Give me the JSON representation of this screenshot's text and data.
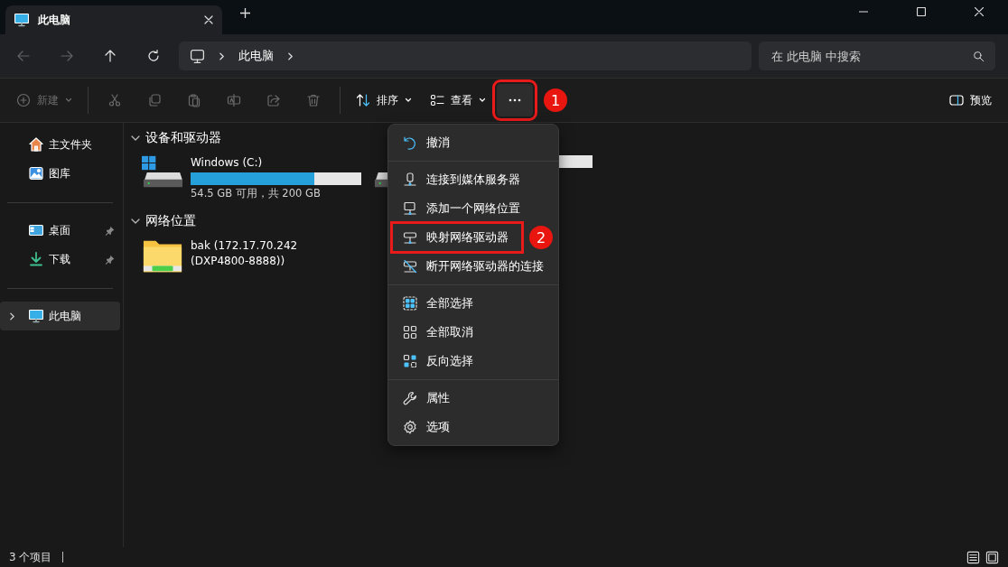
{
  "tab": {
    "title": "此电脑"
  },
  "nav": [
    {
      "kind": "back",
      "disabled": true
    },
    {
      "kind": "forward",
      "disabled": true
    },
    {
      "kind": "up",
      "disabled": false
    },
    {
      "kind": "refresh",
      "disabled": false
    }
  ],
  "address_bar": {
    "path": [
      "此电脑"
    ]
  },
  "search": {
    "placeholder": "在 此电脑 中搜索"
  },
  "toolbar": {
    "items": [
      {
        "kind": "new",
        "label": "新建",
        "disabled": true,
        "dropdown": true
      },
      {
        "kind": "cut",
        "disabled": true
      },
      {
        "kind": "copy",
        "disabled": true
      },
      {
        "kind": "paste",
        "disabled": true
      },
      {
        "kind": "rename",
        "disabled": true
      },
      {
        "kind": "share",
        "disabled": true
      },
      {
        "kind": "delete",
        "disabled": true
      },
      {
        "kind": "sort",
        "label": "排序",
        "disabled": false,
        "dropdown": true
      },
      {
        "kind": "view",
        "label": "查看",
        "disabled": false,
        "dropdown": true
      },
      {
        "kind": "more",
        "disabled": false,
        "highlighted": true,
        "step": "1"
      }
    ],
    "preview": {
      "label": "预览"
    }
  },
  "sidebar": {
    "groups": [
      [
        {
          "kind": "home",
          "label": "主文件夹",
          "pinned": false,
          "selected": false,
          "expandable": false
        },
        {
          "kind": "gallery",
          "label": "图库",
          "pinned": false,
          "selected": false,
          "expandable": false
        }
      ],
      [
        {
          "kind": "desktop",
          "label": "桌面",
          "pinned": true,
          "selected": false,
          "expandable": false
        },
        {
          "kind": "download",
          "label": "下载",
          "pinned": true,
          "selected": false,
          "expandable": false
        }
      ],
      [
        {
          "kind": "pc",
          "label": "此电脑",
          "pinned": false,
          "selected": true,
          "expandable": true
        }
      ]
    ]
  },
  "sections": [
    {
      "title": "设备和驱动器",
      "expanded": true,
      "items": [
        {
          "kind": "system-drive",
          "name": "Windows (C:)",
          "level": 0.725,
          "space": "54.5 GB 可用，共 200 GB"
        },
        {
          "kind": "drive"
        }
      ]
    },
    {
      "title": "网络位置",
      "expanded": true,
      "items": [
        {
          "kind": "network-folder",
          "name": "bak (172.17.70.242",
          "name_line_2": "(DXP4800-8888))"
        }
      ]
    }
  ],
  "menu": {
    "groups": [
      [
        {
          "kind": "undo",
          "label": "撤消",
          "highlighted": false
        }
      ],
      [
        {
          "kind": "media-server",
          "label": "连接到媒体服务器",
          "highlighted": false
        },
        {
          "kind": "network-location",
          "label": "添加一个网络位置",
          "highlighted": false
        },
        {
          "kind": "map-drive",
          "label": "映射网络驱动器",
          "highlighted": true,
          "step": "2"
        },
        {
          "kind": "disconnect-drive",
          "label": "断开网络驱动器的连接",
          "highlighted": false
        }
      ],
      [
        {
          "kind": "select-all",
          "label": "全部选择",
          "highlighted": false
        },
        {
          "kind": "select-none",
          "label": "全部取消",
          "highlighted": false
        },
        {
          "kind": "invert",
          "label": "反向选择",
          "highlighted": false
        }
      ],
      [
        {
          "kind": "properties",
          "label": "属性",
          "highlighted": false
        },
        {
          "kind": "options",
          "label": "选项",
          "highlighted": false
        }
      ]
    ]
  },
  "status_bar": {
    "count": "3 个项目"
  }
}
